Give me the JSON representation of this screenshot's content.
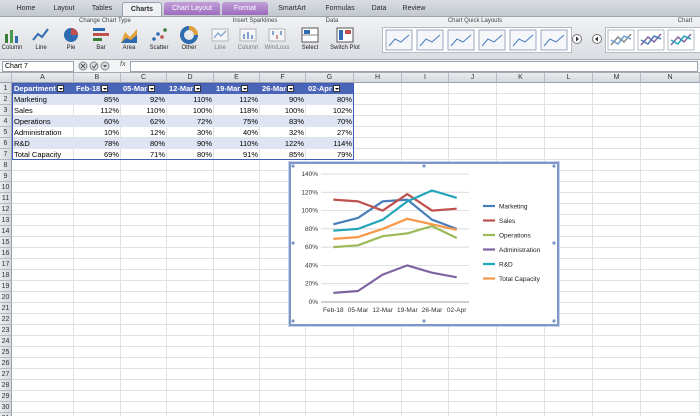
{
  "ribbon": {
    "tabs": [
      "Home",
      "Layout",
      "Tables",
      "Charts",
      "Chart Layout",
      "Format",
      "SmartArt",
      "Formulas",
      "Data",
      "Review"
    ],
    "groups": {
      "change_chart_type": "Change Chart Type",
      "insert_sparklines": "Insert Sparklines",
      "data": "Data",
      "chart_quick_layouts": "Chart Quick Layouts",
      "chart_styles": "Chart"
    },
    "chart_buttons": [
      "Column",
      "Line",
      "Pie",
      "Bar",
      "Area",
      "Scatter",
      "Other"
    ],
    "sparkline_buttons": [
      "Line",
      "Column",
      "Win/Loss"
    ],
    "data_buttons": [
      "Select",
      "Switch Plot"
    ]
  },
  "formula_bar": {
    "name_box": "Chart 7",
    "fx": "fx",
    "value": ""
  },
  "grid": {
    "columns": [
      "A",
      "B",
      "C",
      "D",
      "E",
      "F",
      "G",
      "H",
      "I",
      "J",
      "K",
      "L",
      "M",
      "N"
    ],
    "rows": [
      "1",
      "2",
      "3",
      "4",
      "5",
      "6",
      "7",
      "8",
      "9",
      "10",
      "11",
      "12",
      "13",
      "14",
      "15",
      "16",
      "17",
      "18",
      "19",
      "20",
      "21",
      "22",
      "23",
      "24",
      "25",
      "26",
      "27",
      "28",
      "29",
      "30",
      "31",
      "32"
    ]
  },
  "table": {
    "headers": [
      "Department",
      "Feb-18",
      "05-Mar",
      "12-Mar",
      "19-Mar",
      "26-Mar",
      "02-Apr"
    ],
    "rows": [
      [
        "Marketing",
        "85%",
        "92%",
        "110%",
        "112%",
        "90%",
        "80%"
      ],
      [
        "Sales",
        "112%",
        "110%",
        "100%",
        "118%",
        "100%",
        "102%"
      ],
      [
        "Operations",
        "60%",
        "62%",
        "72%",
        "75%",
        "83%",
        "70%"
      ],
      [
        "Administration",
        "10%",
        "12%",
        "30%",
        "40%",
        "32%",
        "27%"
      ],
      [
        "R&D",
        "78%",
        "80%",
        "90%",
        "110%",
        "122%",
        "114%"
      ],
      [
        "Total Capacity",
        "69%",
        "71%",
        "80%",
        "91%",
        "85%",
        "79%"
      ]
    ]
  },
  "chart_data": {
    "type": "line",
    "categories": [
      "Feb-18",
      "05-Mar",
      "12-Mar",
      "19-Mar",
      "26-Mar",
      "02-Apr"
    ],
    "y_tick_labels": [
      "0%",
      "20%",
      "40%",
      "60%",
      "80%",
      "100%",
      "120%",
      "140%"
    ],
    "ylim": [
      0,
      140
    ],
    "grid": true,
    "legend": "right",
    "series": [
      {
        "name": "Marketing",
        "values": [
          85,
          92,
          110,
          112,
          90,
          80
        ],
        "color": "#4a7ebb"
      },
      {
        "name": "Sales",
        "values": [
          112,
          110,
          100,
          118,
          100,
          102
        ],
        "color": "#c0504d"
      },
      {
        "name": "Operations",
        "values": [
          60,
          62,
          72,
          75,
          83,
          70
        ],
        "color": "#9bbb59"
      },
      {
        "name": "Administration",
        "values": [
          10,
          12,
          30,
          40,
          32,
          27
        ],
        "color": "#8064a2"
      },
      {
        "name": "R&D",
        "values": [
          78,
          80,
          90,
          110,
          122,
          114
        ],
        "color": "#23a5b9"
      },
      {
        "name": "Total Capacity",
        "values": [
          69,
          71,
          80,
          91,
          85,
          79
        ],
        "color": "#f79646"
      }
    ]
  }
}
